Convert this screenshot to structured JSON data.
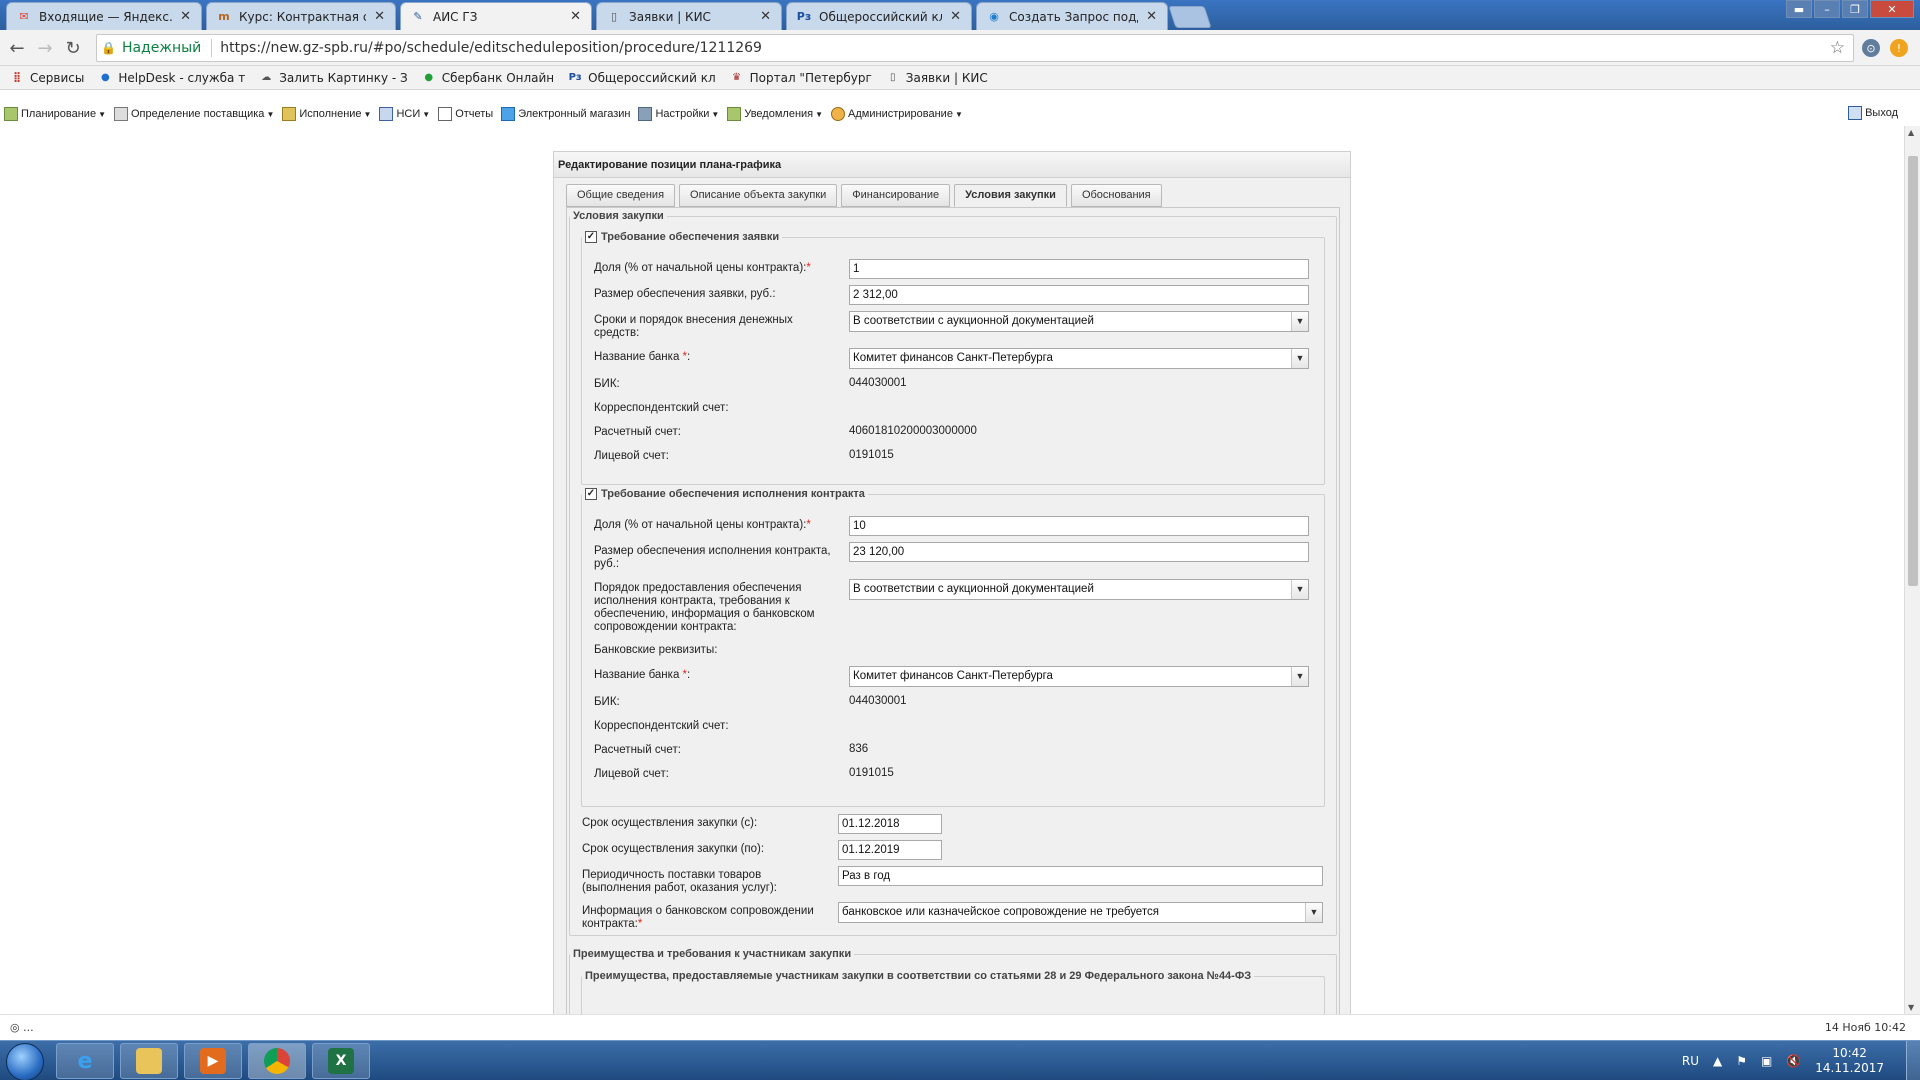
{
  "browser": {
    "tabs": [
      {
        "label": "Входящие — Яндекс.По",
        "icon": "mail-icon",
        "active": false
      },
      {
        "label": "Курс: Контрактная систе",
        "icon": "course-icon",
        "active": false
      },
      {
        "label": "АИС ГЗ",
        "icon": "ais-icon",
        "active": true
      },
      {
        "label": "Заявки | КИС",
        "icon": "page-icon",
        "active": false
      },
      {
        "label": "Общероссийский класс",
        "icon": "pz-icon",
        "active": false
      },
      {
        "label": "Создать Запрос поддер",
        "icon": "support-icon",
        "active": false
      }
    ],
    "secure_label": "Надежный",
    "url": "https://new.gz-spb.ru/#po/schedule/editscheduleposition/procedure/1211269",
    "bookmarks": [
      {
        "label": "Сервисы",
        "icon": "apps-grid-icon"
      },
      {
        "label": "HelpDesk - служба т",
        "icon": "helpdesk-icon"
      },
      {
        "label": "Залить Картинку - З",
        "icon": "image-upload-icon"
      },
      {
        "label": "Сбербанк Онлайн",
        "icon": "sberbank-icon"
      },
      {
        "label": "Общероссийский кл",
        "icon": "pz-icon"
      },
      {
        "label": "Портал \"Петербург",
        "icon": "portal-icon"
      },
      {
        "label": "Заявки | КИС",
        "icon": "page-icon"
      }
    ]
  },
  "app": {
    "menu": [
      {
        "label": "Планирование",
        "dropdown": true
      },
      {
        "label": "Определение поставщика",
        "dropdown": true
      },
      {
        "label": "Исполнение",
        "dropdown": true
      },
      {
        "label": "НСИ",
        "dropdown": true
      },
      {
        "label": "Отчеты",
        "dropdown": false
      },
      {
        "label": "Электронный магазин",
        "dropdown": false
      },
      {
        "label": "Настройки",
        "dropdown": true
      },
      {
        "label": "Уведомления",
        "dropdown": true
      },
      {
        "label": "Администрирование",
        "dropdown": true
      }
    ],
    "logout_label": "Выход"
  },
  "form": {
    "title": "Редактирование позиции плана-графика",
    "tabs": [
      "Общие сведения",
      "Описание объекта закупки",
      "Финансирование",
      "Условия закупки",
      "Обоснования"
    ],
    "active_tab": "Условия закупки",
    "section_title": "Условия закупки",
    "app_security": {
      "legend": "Требование обеспечения заявки",
      "checked": true,
      "share_label": "Доля (% от начальной цены контракта):",
      "share_value": "1",
      "amount_label": "Размер обеспечения заявки, руб.:",
      "amount_value": "2 312,00",
      "terms_label": "Сроки и порядок внесения денежных средств:",
      "terms_value": "В соответствии с аукционной документацией",
      "bank_label": "Название банка",
      "bank_value": "Комитет финансов Санкт-Петербурга",
      "bik_label": "БИК:",
      "bik_value": "044030001",
      "corr_label": "Корреспондентский счет:",
      "corr_value": "",
      "settle_label": "Расчетный счет:",
      "settle_value": "40601810200003000000",
      "personal_label": "Лицевой счет:",
      "personal_value": "0191015"
    },
    "contract_security": {
      "legend": "Требование обеспечения исполнения контракта",
      "checked": true,
      "share_label": "Доля (% от начальной цены контракта):",
      "share_value": "10",
      "amount_label": "Размер обеспечения исполнения контракта, руб.:",
      "amount_value": "23 120,00",
      "procedure_label": "Порядок предоставления обеспечения исполнения контракта, требования к обеспечению, информация о банковском сопровождении контракта:",
      "procedure_value": "В соответствии с аукционной документацией",
      "bank_details_label": "Банковские реквизиты:",
      "bank_label": "Название банка",
      "bank_value": "Комитет финансов Санкт-Петербурга",
      "bik_label": "БИК:",
      "bik_value": "044030001",
      "corr_label": "Корреспондентский счет:",
      "corr_value": "",
      "settle_label": "Расчетный счет:",
      "settle_value": "836",
      "personal_label": "Лицевой счет:",
      "personal_value": "0191015"
    },
    "period_from_label": "Срок осуществления закупки (с):",
    "period_from_value": "01.12.2018",
    "period_to_label": "Срок осуществления закупки (по):",
    "period_to_value": "01.12.2019",
    "periodicity_label": "Периодичность поставки товаров (выполнения работ, оказания услуг):",
    "periodicity_value": "Раз в год",
    "bank_support_label": "Информация о банковском сопровождении контракта:",
    "bank_support_value": "банковское или казначейское сопровождение не требуется",
    "advantages_legend": "Преимущества и требования к участникам закупки",
    "advantages_sub_legend": "Преимущества, предоставляемые участникам закупки в соответствии со статьями 28 и 29 Федерального закона №44-ФЗ"
  },
  "statusbar": {
    "left": "◎ ...",
    "right": "14 Нояб 10:42"
  },
  "taskbar": {
    "lang": "RU",
    "time": "10:42",
    "date": "14.11.2017"
  },
  "colors": {
    "required": "#e0281e",
    "taskbar": "#2b5797"
  }
}
